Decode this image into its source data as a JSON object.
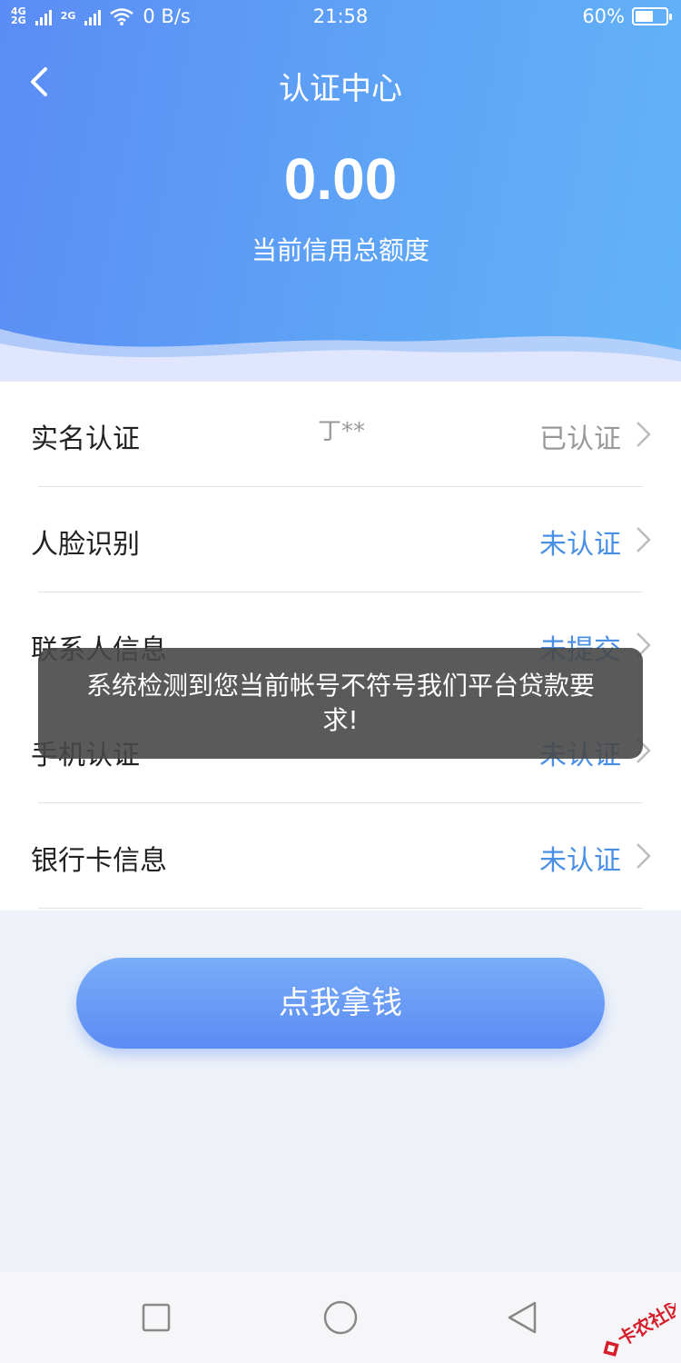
{
  "status_bar": {
    "network_top": "4G",
    "network_bottom": "2G",
    "network_2": "2G",
    "speed": "0 B/s",
    "time": "21:58",
    "battery_percent": "60%",
    "battery_level": 0.6
  },
  "header": {
    "title": "认证中心",
    "amount": "0.00",
    "amount_label": "当前信用总额度"
  },
  "items": [
    {
      "label": "实名认证",
      "extra": "丁**",
      "status": "已认证",
      "status_color": "#999999"
    },
    {
      "label": "人脸识别",
      "status": "未认证",
      "status_color": "#4a8fe6"
    },
    {
      "label": "联系人信息",
      "status": "未提交",
      "status_color": "#4a8fe6"
    },
    {
      "label": "手机认证",
      "status": "未认证",
      "status_color": "#4a8fe6"
    },
    {
      "label": "银行卡信息",
      "status": "未认证",
      "status_color": "#4a8fe6"
    }
  ],
  "toast": "系统检测到您当前帐号不符号我们平台贷款要求!",
  "cta": "点我拿钱",
  "watermark": "卡农社区",
  "colors": {
    "header_start": "#5b8cf5",
    "header_end": "#63b3f7",
    "link_blue": "#4a8fe6"
  }
}
